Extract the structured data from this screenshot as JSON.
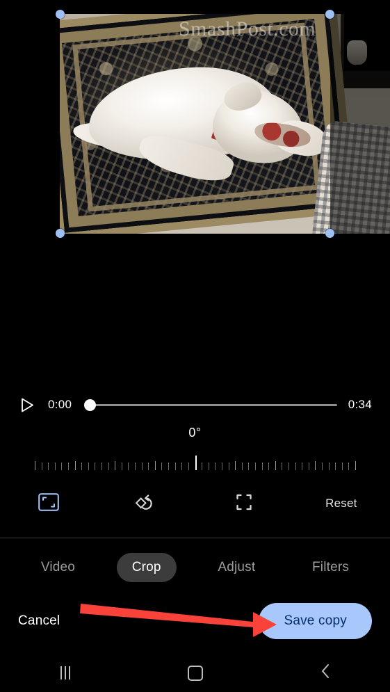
{
  "app": {
    "screen_name": "Video editor - Crop",
    "background_color": "#000000",
    "accent_color": "#a8c7fa"
  },
  "preview": {
    "watermark_text": "SmashPost.com",
    "crop_handles": [
      {
        "name": "top-left"
      },
      {
        "name": "top-right"
      },
      {
        "name": "bottom-left"
      },
      {
        "name": "bottom-right"
      }
    ],
    "handle_color": "#9fc0f5",
    "photo_description": "White dog lying on an ornate dark patterned rug chewing a red toy"
  },
  "playback": {
    "play_icon": "play-icon",
    "current_time": "0:00",
    "total_time": "0:34",
    "progress_percent": 0
  },
  "rotation": {
    "value_label": "0°",
    "degrees": 0,
    "tick_count": 49
  },
  "tools": {
    "items": [
      {
        "name": "aspect-ratio",
        "icon": "aspect-ratio-icon",
        "active": true
      },
      {
        "name": "rotate",
        "icon": "rotate-icon",
        "active": false
      },
      {
        "name": "free-crop",
        "icon": "free-crop-icon",
        "active": false
      }
    ],
    "reset_label": "Reset"
  },
  "tabs": [
    {
      "label": "Video",
      "active": false
    },
    {
      "label": "Crop",
      "active": true
    },
    {
      "label": "Adjust",
      "active": false
    },
    {
      "label": "Filters",
      "active": false
    }
  ],
  "actions": {
    "cancel_label": "Cancel",
    "save_label": "Save copy",
    "save_bg": "#a8c7fa",
    "save_fg": "#062e6f"
  },
  "annotation": {
    "arrow_color": "#f9423a",
    "points_to": "Save copy"
  },
  "navbar": {
    "recents": "recents-icon",
    "home": "home-icon",
    "back": "back-icon"
  }
}
